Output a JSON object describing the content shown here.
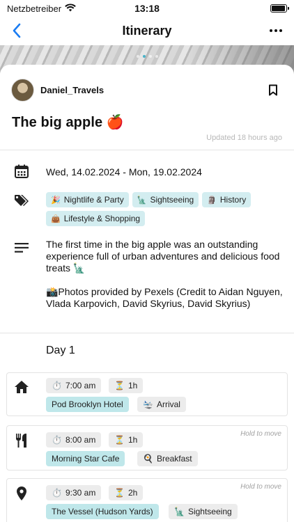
{
  "status": {
    "carrier": "Netzbetreiber",
    "time": "13:18",
    "battery_level": 0.95
  },
  "nav": {
    "title": "Itinerary",
    "back_icon": "chevron-left-icon",
    "more_icon": "ellipsis-icon"
  },
  "hero": {
    "page_count": 4,
    "active_page": 1
  },
  "author": {
    "name": "Daniel_Travels"
  },
  "trip": {
    "title": "The big apple 🍎",
    "updated": "Updated 18 hours ago",
    "dates": "Wed, 14.02.2024 - Mon, 19.02.2024",
    "tags": [
      {
        "emoji": "🎉",
        "label": "Nightlife & Party"
      },
      {
        "emoji": "🗽",
        "label": "Sightseeing"
      },
      {
        "emoji": "🗿",
        "label": "History"
      },
      {
        "emoji": "👜",
        "label": "Lifestyle & Shopping"
      }
    ],
    "description": [
      "The first time in the big apple was an outstanding experience full of urban adventures and delicious food treats 🗽",
      "📸Photos provided by Pexels (Credit to Aidan Nguyen, Vlada Karpovich, David Skyrius, David Skyrius)"
    ]
  },
  "day": {
    "label": "Day 1"
  },
  "stops": [
    {
      "icon": "home-icon",
      "time_emoji": "⏱️",
      "time": "7:00 am",
      "duration_emoji": "⏳",
      "duration": "1h",
      "place": "Pod Brooklyn Hotel",
      "type_emoji": "🛬",
      "type": "Arrival",
      "hold": ""
    },
    {
      "icon": "restaurant-icon",
      "time_emoji": "⏱️",
      "time": "8:00 am",
      "duration_emoji": "⏳",
      "duration": "1h",
      "place": "Morning Star Cafe",
      "type_emoji": "🍳",
      "type": "Breakfast",
      "hold": "Hold to move"
    },
    {
      "icon": "location-pin-icon",
      "time_emoji": "⏱️",
      "time": "9:30 am",
      "duration_emoji": "⏳",
      "duration": "2h",
      "place": "The Vessel (Hudson Yards)",
      "type_emoji": "🗽",
      "type": "Sightseeing",
      "hold": "Hold to move"
    }
  ],
  "colors": {
    "accent": "#1a7cf2",
    "tag_bg": "#d3edf0",
    "place_chip_bg": "#bfe7ea",
    "chip_gray": "#ececec",
    "muted_text": "#b8b8b8"
  }
}
